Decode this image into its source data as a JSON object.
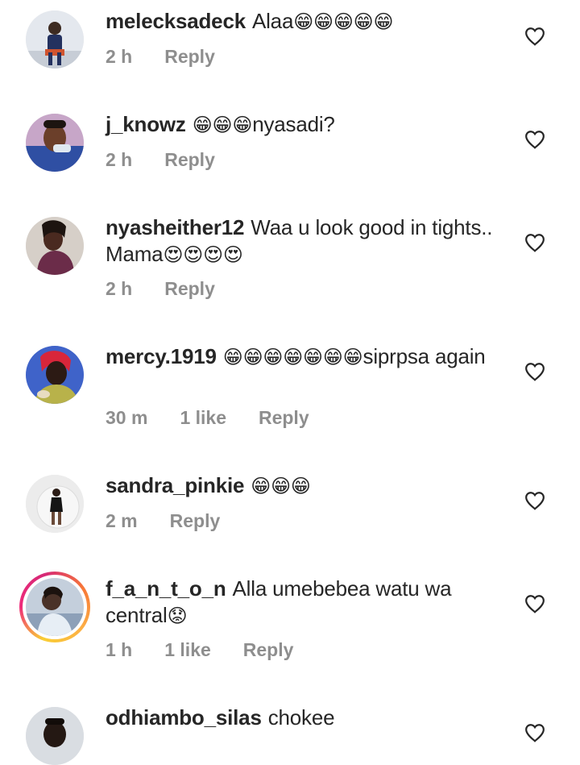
{
  "comments": [
    {
      "username": "melecksadeck",
      "text": "Alaa",
      "emojis": "😁😁😁😁😁",
      "emoji_after": "",
      "time": "2 h",
      "likes": "",
      "reply": "Reply",
      "avatar_bg": "#cfd7e3"
    },
    {
      "username": "j_knowz",
      "text": "",
      "emojis": "😁😁😁",
      "emoji_after": "nyasadi?",
      "time": "2 h",
      "likes": "",
      "reply": "Reply",
      "avatar_bg": "#3a5fa8"
    },
    {
      "username": "nyasheither12",
      "text": "Waa u look good in tights.. Mama",
      "emojis": "😍😍😍😍",
      "emoji_after": "",
      "time": "2 h",
      "likes": "",
      "reply": "Reply",
      "avatar_bg": "#6a3b4a"
    },
    {
      "username": "mercy.1919",
      "text": "",
      "emojis": "😁😁😁😁😁😁😁",
      "emoji_after": "siprpsa again",
      "time": "30 m",
      "likes": "1 like",
      "reply": "Reply",
      "avatar_bg": "#4a6fd8"
    },
    {
      "username": "sandra_pinkie",
      "text": "",
      "emojis": "😁😁😁",
      "emoji_after": "",
      "time": "2 m",
      "likes": "",
      "reply": "Reply",
      "avatar_bg": "#e2dede"
    },
    {
      "username": "f_a_n_t_o_n",
      "text": "Alla umebebea watu wa central",
      "emojis": "😟",
      "emoji_after": "",
      "time": "1 h",
      "likes": "1 like",
      "reply": "Reply",
      "avatar_bg": "#b9c7d8"
    },
    {
      "username": "odhiambo_silas",
      "text": "chokee",
      "emojis": "",
      "emoji_after": "",
      "time": "",
      "likes": "",
      "reply": "",
      "avatar_bg": "#d9dde2"
    }
  ],
  "icons": {
    "heart": "heart-outline-icon"
  },
  "colors": {
    "text": "#262626",
    "meta": "#8e8e8e",
    "background": "#ffffff"
  }
}
